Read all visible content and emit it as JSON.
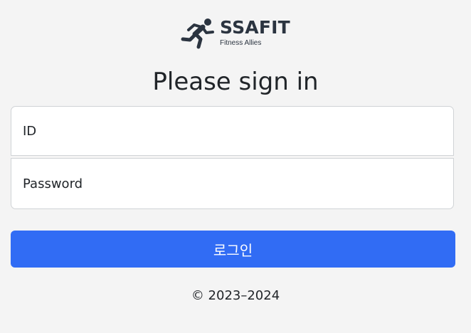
{
  "logo": {
    "title": "SSAFIT",
    "subtitle": "Fitness Allies",
    "icon": "running-person-icon",
    "color": "#2b3440"
  },
  "heading": "Please sign in",
  "form": {
    "id_placeholder": "ID",
    "password_placeholder": "Password",
    "login_label": "로그인"
  },
  "footer": {
    "copyright": "© 2023–2024"
  },
  "colors": {
    "background": "#f4f4f4",
    "primary": "#316cf4",
    "text": "#212529"
  }
}
